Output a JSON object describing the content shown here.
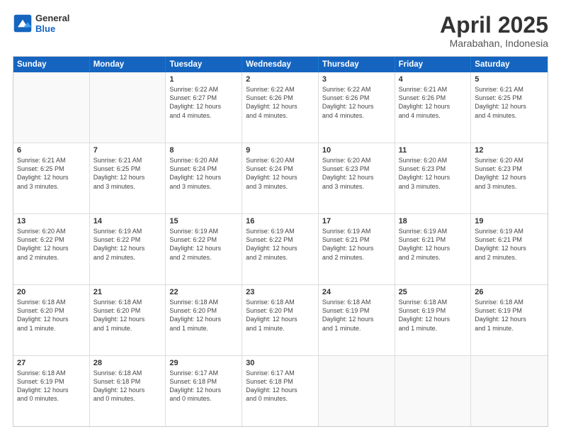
{
  "header": {
    "logo": {
      "general": "General",
      "blue": "Blue"
    },
    "title": "April 2025",
    "location": "Marabahan, Indonesia"
  },
  "days_of_week": [
    "Sunday",
    "Monday",
    "Tuesday",
    "Wednesday",
    "Thursday",
    "Friday",
    "Saturday"
  ],
  "weeks": [
    [
      {
        "day": "",
        "detail": ""
      },
      {
        "day": "",
        "detail": ""
      },
      {
        "day": "1",
        "detail": "Sunrise: 6:22 AM\nSunset: 6:27 PM\nDaylight: 12 hours\nand 4 minutes."
      },
      {
        "day": "2",
        "detail": "Sunrise: 6:22 AM\nSunset: 6:26 PM\nDaylight: 12 hours\nand 4 minutes."
      },
      {
        "day": "3",
        "detail": "Sunrise: 6:22 AM\nSunset: 6:26 PM\nDaylight: 12 hours\nand 4 minutes."
      },
      {
        "day": "4",
        "detail": "Sunrise: 6:21 AM\nSunset: 6:26 PM\nDaylight: 12 hours\nand 4 minutes."
      },
      {
        "day": "5",
        "detail": "Sunrise: 6:21 AM\nSunset: 6:25 PM\nDaylight: 12 hours\nand 4 minutes."
      }
    ],
    [
      {
        "day": "6",
        "detail": "Sunrise: 6:21 AM\nSunset: 6:25 PM\nDaylight: 12 hours\nand 3 minutes."
      },
      {
        "day": "7",
        "detail": "Sunrise: 6:21 AM\nSunset: 6:25 PM\nDaylight: 12 hours\nand 3 minutes."
      },
      {
        "day": "8",
        "detail": "Sunrise: 6:20 AM\nSunset: 6:24 PM\nDaylight: 12 hours\nand 3 minutes."
      },
      {
        "day": "9",
        "detail": "Sunrise: 6:20 AM\nSunset: 6:24 PM\nDaylight: 12 hours\nand 3 minutes."
      },
      {
        "day": "10",
        "detail": "Sunrise: 6:20 AM\nSunset: 6:23 PM\nDaylight: 12 hours\nand 3 minutes."
      },
      {
        "day": "11",
        "detail": "Sunrise: 6:20 AM\nSunset: 6:23 PM\nDaylight: 12 hours\nand 3 minutes."
      },
      {
        "day": "12",
        "detail": "Sunrise: 6:20 AM\nSunset: 6:23 PM\nDaylight: 12 hours\nand 3 minutes."
      }
    ],
    [
      {
        "day": "13",
        "detail": "Sunrise: 6:20 AM\nSunset: 6:22 PM\nDaylight: 12 hours\nand 2 minutes."
      },
      {
        "day": "14",
        "detail": "Sunrise: 6:19 AM\nSunset: 6:22 PM\nDaylight: 12 hours\nand 2 minutes."
      },
      {
        "day": "15",
        "detail": "Sunrise: 6:19 AM\nSunset: 6:22 PM\nDaylight: 12 hours\nand 2 minutes."
      },
      {
        "day": "16",
        "detail": "Sunrise: 6:19 AM\nSunset: 6:22 PM\nDaylight: 12 hours\nand 2 minutes."
      },
      {
        "day": "17",
        "detail": "Sunrise: 6:19 AM\nSunset: 6:21 PM\nDaylight: 12 hours\nand 2 minutes."
      },
      {
        "day": "18",
        "detail": "Sunrise: 6:19 AM\nSunset: 6:21 PM\nDaylight: 12 hours\nand 2 minutes."
      },
      {
        "day": "19",
        "detail": "Sunrise: 6:19 AM\nSunset: 6:21 PM\nDaylight: 12 hours\nand 2 minutes."
      }
    ],
    [
      {
        "day": "20",
        "detail": "Sunrise: 6:18 AM\nSunset: 6:20 PM\nDaylight: 12 hours\nand 1 minute."
      },
      {
        "day": "21",
        "detail": "Sunrise: 6:18 AM\nSunset: 6:20 PM\nDaylight: 12 hours\nand 1 minute."
      },
      {
        "day": "22",
        "detail": "Sunrise: 6:18 AM\nSunset: 6:20 PM\nDaylight: 12 hours\nand 1 minute."
      },
      {
        "day": "23",
        "detail": "Sunrise: 6:18 AM\nSunset: 6:20 PM\nDaylight: 12 hours\nand 1 minute."
      },
      {
        "day": "24",
        "detail": "Sunrise: 6:18 AM\nSunset: 6:19 PM\nDaylight: 12 hours\nand 1 minute."
      },
      {
        "day": "25",
        "detail": "Sunrise: 6:18 AM\nSunset: 6:19 PM\nDaylight: 12 hours\nand 1 minute."
      },
      {
        "day": "26",
        "detail": "Sunrise: 6:18 AM\nSunset: 6:19 PM\nDaylight: 12 hours\nand 1 minute."
      }
    ],
    [
      {
        "day": "27",
        "detail": "Sunrise: 6:18 AM\nSunset: 6:19 PM\nDaylight: 12 hours\nand 0 minutes."
      },
      {
        "day": "28",
        "detail": "Sunrise: 6:18 AM\nSunset: 6:18 PM\nDaylight: 12 hours\nand 0 minutes."
      },
      {
        "day": "29",
        "detail": "Sunrise: 6:17 AM\nSunset: 6:18 PM\nDaylight: 12 hours\nand 0 minutes."
      },
      {
        "day": "30",
        "detail": "Sunrise: 6:17 AM\nSunset: 6:18 PM\nDaylight: 12 hours\nand 0 minutes."
      },
      {
        "day": "",
        "detail": ""
      },
      {
        "day": "",
        "detail": ""
      },
      {
        "day": "",
        "detail": ""
      }
    ]
  ]
}
